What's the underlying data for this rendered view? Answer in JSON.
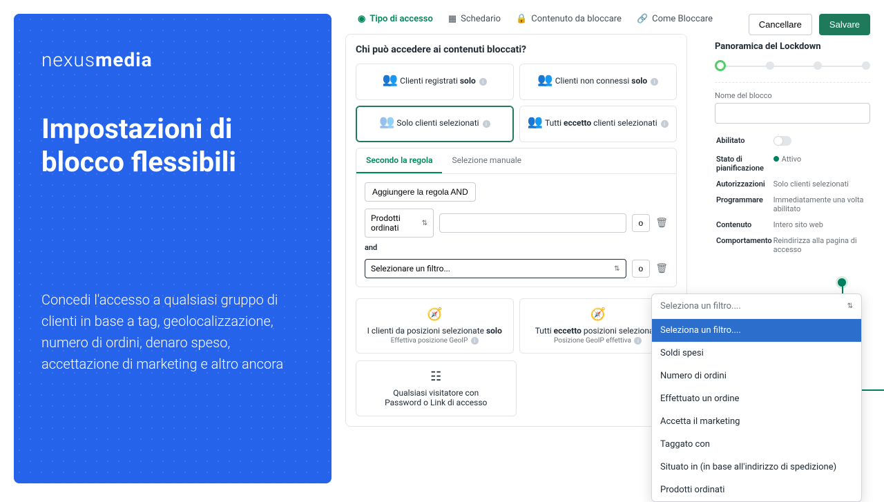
{
  "brand_light": "nexus",
  "brand_bold": "media",
  "hero_title": "Impostazioni di blocco flessibili",
  "hero_desc": "Concedi l'accesso a qualsiasi gruppo di clienti in base a tag, geolocalizzazione, numero di ordini, denaro speso, accettazione di marketing e altro ancora",
  "tabs": {
    "access": "Tipo di accesso",
    "schedule": "Schedario",
    "content": "Contenuto da bloccare",
    "how": "Come Bloccare"
  },
  "buttons": {
    "cancel": "Cancellare",
    "save": "Salvare"
  },
  "card": {
    "title": "Chi può accedere ai contenuti bloccati?",
    "opt_registered": "Clienti registrati ",
    "opt_registered_b": "solo",
    "opt_not_connected": "Clienti non connessi ",
    "opt_not_connected_b": "solo",
    "opt_selected": "Solo clienti selezionati",
    "opt_all_except_a": "Tutti ",
    "opt_all_except_b": "eccetto",
    "opt_all_except_c": " clienti selezionati"
  },
  "rule": {
    "tab_rule": "Secondo la regola",
    "tab_manual": "Selezione manuale",
    "add_and": "Aggiungere la regola AND",
    "products_ordered": "Prodotti ordinati",
    "and": "and",
    "select_filter": "Selezionare un filtro...",
    "or": "o"
  },
  "geo": {
    "opt1_a": "I clienti da posizioni selezionate ",
    "opt1_b": "solo",
    "opt1_sub": "Effettiva posizione GeoIP",
    "opt2_a": "Tutti ",
    "opt2_b": "eccetto",
    "opt2_c": " posizioni selezionate",
    "opt2_sub": "Posizione GeoIP effettiva",
    "opt3_a": "Qualsiasi visitatore con",
    "opt3_b": "Password o Link di accesso"
  },
  "overview": {
    "title": "Panoramica del Lockdown",
    "name_label": "Nome del blocco",
    "enabled": "Abilitato",
    "plan_status_k": "Stato di pianificazione",
    "plan_status_v": "Attivo",
    "auth_k": "Autorizzazioni",
    "auth_v": "Solo clienti selezionati",
    "sched_k": "Programmare",
    "sched_v": "Immediatamente una volta abilitato",
    "content_k": "Contenuto",
    "content_v": "Intero sito web",
    "behavior_k": "Comportamento",
    "behavior_v": "Reindirizza alla pagina di accesso"
  },
  "dropdown": {
    "header": "Seleziona un filtro....",
    "items": [
      "Seleziona un filtro....",
      "Soldi spesi",
      "Numero di ordini",
      "Effettuato un ordine",
      "Accetta il marketing",
      "Taggato con",
      "Situato in (in base all'indirizzo di spedizione)",
      "Prodotti ordinati"
    ]
  }
}
